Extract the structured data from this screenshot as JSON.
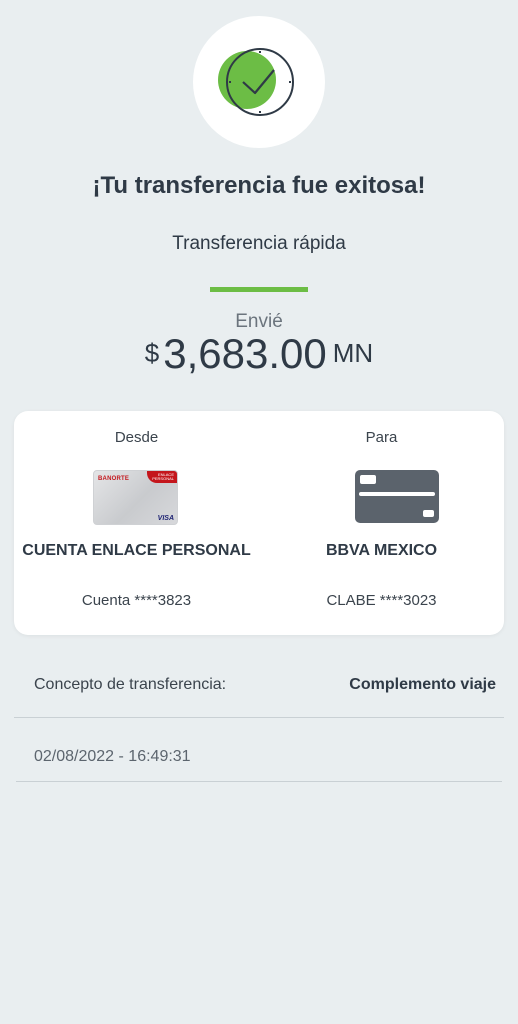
{
  "header": {
    "icon": "check-clock-icon",
    "title": "¡Tu transferencia fue exitosa!",
    "subtitle": "Transferencia rápida"
  },
  "amount": {
    "label": "Envié",
    "currency_symbol": "$",
    "value": "3,683.00",
    "unit": "MN"
  },
  "from": {
    "label": "Desde",
    "name": "CUENTA ENLACE PERSONAL",
    "number": "Cuenta ****3823",
    "card_bank": "BANORTE",
    "card_tag": "ENLACE PERSONAL",
    "card_network": "VISA"
  },
  "to": {
    "label": "Para",
    "name": "BBVA MEXICO",
    "number": "CLABE ****3023"
  },
  "concept": {
    "label": "Concepto de transferencia:",
    "value": "Complemento viaje"
  },
  "datetime": "02/08/2022 - 16:49:31",
  "colors": {
    "accent_green": "#6cbd45",
    "background": "#e9eef0",
    "text_dark": "#2f3a46",
    "card_gray": "#5b636c",
    "bank_red": "#c4161c"
  }
}
